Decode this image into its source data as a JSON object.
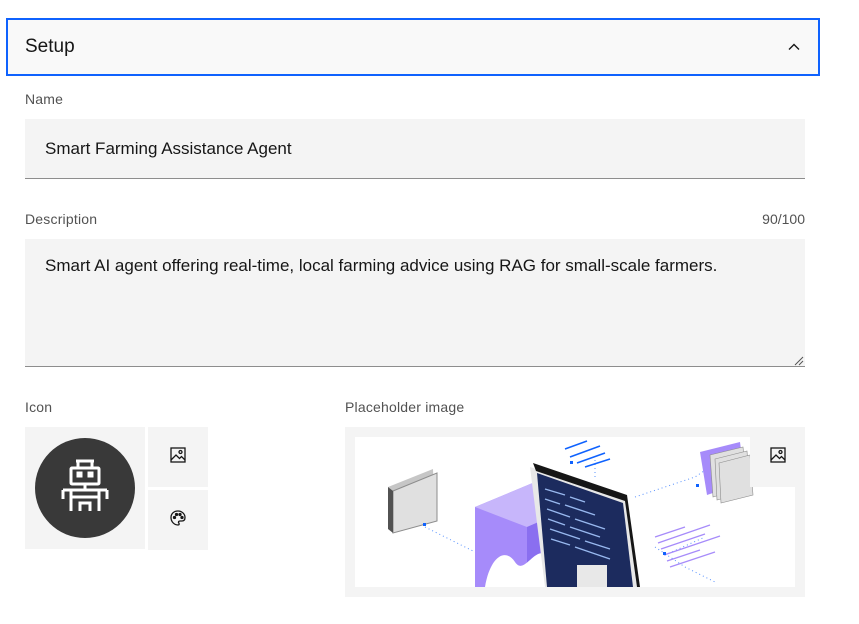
{
  "accordion": {
    "title": "Setup",
    "chevron_icon": "chevron-up-icon"
  },
  "name_field": {
    "label": "Name",
    "value": "Smart Farming Assistance Agent"
  },
  "description_field": {
    "label": "Description",
    "counter": "90/100",
    "value": "Smart AI agent offering real-time, local farming advice using RAG for small-scale farmers."
  },
  "icon_section": {
    "label": "Icon",
    "avatar_icon": "robot-icon",
    "upload_icon": "image-icon",
    "palette_icon": "palette-icon"
  },
  "placeholder_section": {
    "label": "Placeholder image",
    "upload_icon": "image-icon"
  },
  "colors": {
    "focus_border": "#0f62fe",
    "field_bg": "#f4f4f4",
    "avatar_bg": "#393939",
    "accent_purple": "#a68bfa",
    "screen_navy": "#1c2b5e"
  }
}
